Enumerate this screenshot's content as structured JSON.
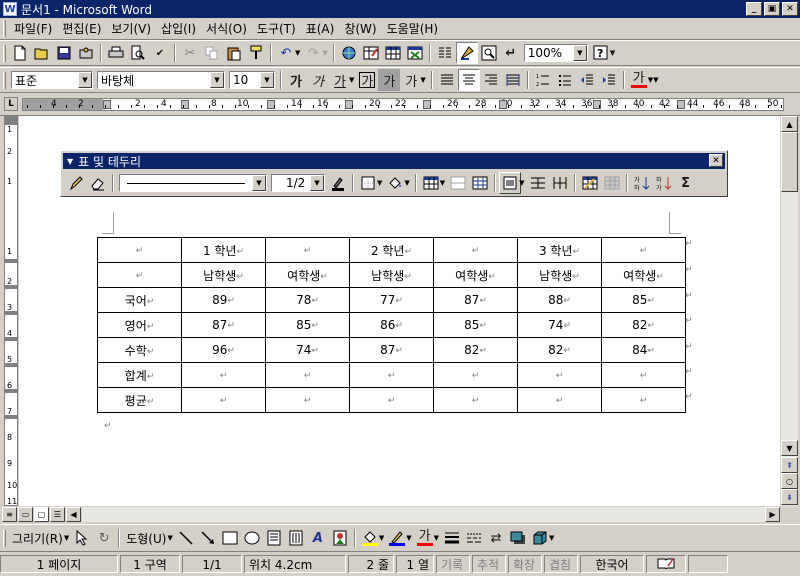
{
  "app": {
    "title": "문서1 - Microsoft Word",
    "icon_label": "W",
    "win_buttons": [
      "_",
      "▣",
      "✕"
    ]
  },
  "menu": {
    "items": [
      "파일(F)",
      "편집(E)",
      "보기(V)",
      "삽입(I)",
      "서식(O)",
      "도구(T)",
      "표(A)",
      "창(W)",
      "도움말(H)"
    ]
  },
  "standard_toolbar": {
    "zoom": "100%"
  },
  "format_toolbar": {
    "style": "표준",
    "font": "바탕체",
    "size": "10",
    "bold": "가",
    "italic": "가",
    "underline": "가",
    "char_border": "가",
    "char_shading": "가",
    "char_scale": "가",
    "font_color": "가"
  },
  "ruler": {
    "corner": "L",
    "numbers": [
      "4",
      "2",
      "2",
      "4",
      "8",
      "10",
      "14",
      "16",
      "20",
      "22",
      "26",
      "28",
      "30",
      "32",
      "34",
      "36",
      "38",
      "40",
      "42",
      "44",
      "46",
      "48",
      "50"
    ],
    "vnumbers": [
      "1",
      "2",
      "1",
      "1",
      "2",
      "3",
      "4",
      "5",
      "6",
      "7",
      "8",
      "9",
      "10",
      "11"
    ]
  },
  "tables_borders_toolbar": {
    "title": "표 및 테두리",
    "line_weight": "1/2",
    "sum_symbol": "Σ"
  },
  "document": {
    "paragraph_mark": "↵",
    "end_of_row_mark": "↵",
    "table": {
      "header1": [
        "",
        "1 학년",
        "",
        "2 학년",
        "",
        "3 학년",
        ""
      ],
      "header2": [
        "",
        "남학생",
        "여학생",
        "남학생",
        "여학생",
        "남학생",
        "여학생"
      ],
      "rows": [
        [
          "국어",
          "89",
          "78",
          "77",
          "87",
          "88",
          "85"
        ],
        [
          "영어",
          "87",
          "85",
          "86",
          "85",
          "74",
          "82"
        ],
        [
          "수학",
          "96",
          "74",
          "87",
          "82",
          "82",
          "84"
        ],
        [
          "합계",
          "",
          "",
          "",
          "",
          "",
          ""
        ],
        [
          "평균",
          "",
          "",
          "",
          "",
          "",
          ""
        ]
      ]
    }
  },
  "drawing_toolbar": {
    "draw_label": "그리기(R)",
    "autoshapes_label": "도형(U)",
    "font_color_glyph": "가"
  },
  "status_bar": {
    "page": "1 페이지",
    "section": "1 구역",
    "page_of": "1/1",
    "position": "위치 4.2cm",
    "line": "2 줄",
    "column": "1 열",
    "rec": "기록",
    "trk": "추적",
    "ext": "확장",
    "ovr": "겹침",
    "language": "한국어"
  },
  "colors": {
    "title_bar": "#0a246a",
    "chrome": "#d4d0c8",
    "font_color_bar": "#ff0000",
    "highlight_bar": "#ffff00",
    "line_color_bar": "#0000ff"
  }
}
